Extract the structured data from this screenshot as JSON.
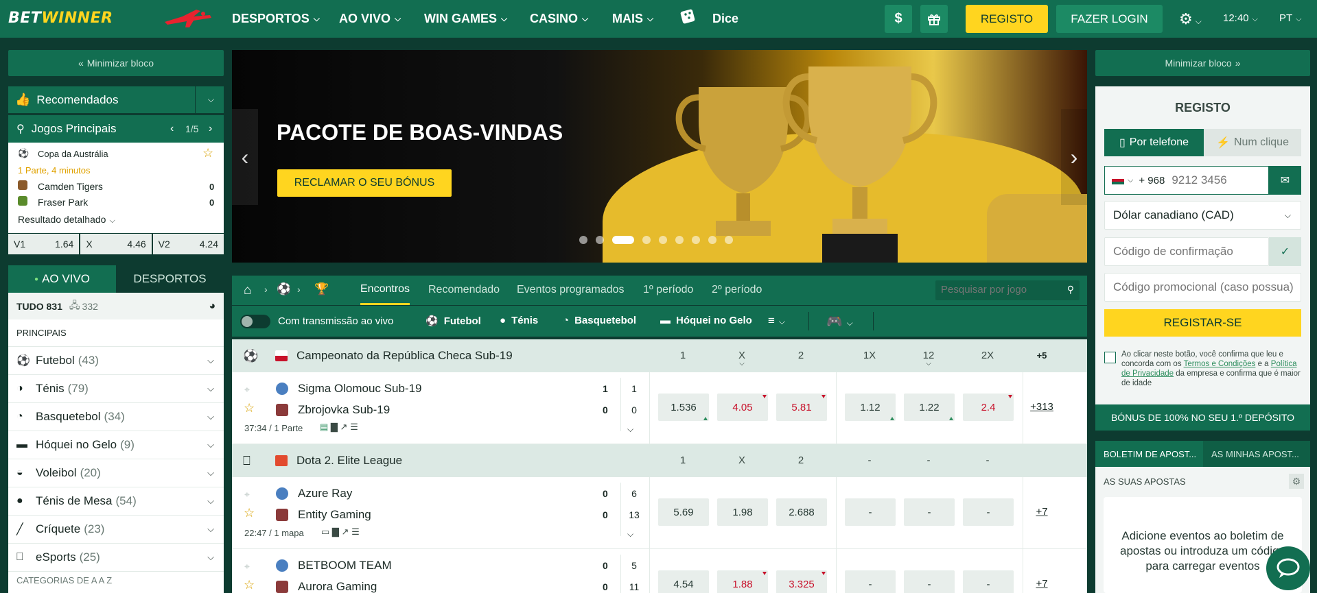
{
  "header": {
    "logo_bet": "BET",
    "logo_winner": "WINNER",
    "nav": [
      {
        "label": "DESPORTOS"
      },
      {
        "label": "AO VIVO"
      },
      {
        "label": "WIN GAMES"
      },
      {
        "label": "CASINO"
      },
      {
        "label": "MAIS"
      }
    ],
    "dice_label": "Dice",
    "register": "REGISTO",
    "login": "FAZER LOGIN",
    "time": "12:40",
    "lang": "PT"
  },
  "left": {
    "minimize": "Minimizar bloco",
    "recommended": "Recomendados",
    "main_games": "Jogos Principais",
    "pager": "1/5",
    "featured": {
      "competition": "Copa da Austrália",
      "status": "1 Parte, 4 minutos",
      "team1": "Camden Tigers",
      "score1": "0",
      "team2": "Fraser Park",
      "score2": "0",
      "detail": "Resultado detalhado",
      "odds": [
        {
          "k": "V1",
          "v": "1.64"
        },
        {
          "k": "X",
          "v": "4.46"
        },
        {
          "k": "V2",
          "v": "4.24"
        }
      ]
    },
    "tab_live": "AO VIVO",
    "tab_sports": "DESPORTOS",
    "all_label": "TUDO 831",
    "screen_count": "332",
    "principal": "PRINCIPAIS",
    "sports": [
      {
        "name": "Futebol",
        "count": "(43)",
        "icon": "soccer-ball-icon"
      },
      {
        "name": "Ténis",
        "count": "(79)",
        "icon": "tennis-ball-icon"
      },
      {
        "name": "Basquetebol",
        "count": "(34)",
        "icon": "basketball-icon"
      },
      {
        "name": "Hóquei no Gelo",
        "count": "(9)",
        "icon": "hockey-puck-icon"
      },
      {
        "name": "Voleibol",
        "count": "(20)",
        "icon": "volleyball-icon"
      },
      {
        "name": "Ténis de Mesa",
        "count": "(54)",
        "icon": "table-tennis-icon"
      },
      {
        "name": "Críquete",
        "count": "(23)",
        "icon": "cricket-icon"
      },
      {
        "name": "eSports",
        "count": "(25)",
        "icon": "gamepad-icon"
      }
    ],
    "categories": "CATEGORIAS DE A A Z"
  },
  "banner": {
    "title": "PACOTE DE BOAS-VINDAS",
    "cta": "RECLAMAR O SEU BÓNUS",
    "dots": 9,
    "active_dot": 3
  },
  "center": {
    "tabs": [
      "Encontros",
      "Recomendado",
      "Eventos programados",
      "1º período",
      "2º período"
    ],
    "search_placeholder": "Pesquisar por jogo",
    "live_stream": "Com transmissão ao vivo",
    "filters": [
      "Futebol",
      "Ténis",
      "Basquetebol",
      "Hóquei no Gelo"
    ],
    "leagues": [
      {
        "name": "Campeonato da República Checa Sub-19",
        "cols": [
          "1",
          "X",
          "2",
          "1X",
          "12",
          "2X"
        ],
        "more": "+5",
        "matches": [
          {
            "t1": "Sigma Olomouc Sub-19",
            "t2": "Zbrojovka Sub-19",
            "s1": "1",
            "s2": "0",
            "p1": "1",
            "p2": "0",
            "info": "37:34 / 1 Parte",
            "odds": [
              "1.536",
              "4.05",
              "5.81",
              "1.12",
              "1.22",
              "2.4"
            ],
            "more": "+313"
          }
        ]
      },
      {
        "name": "Dota 2. Elite League",
        "cols": [
          "1",
          "X",
          "2",
          "-",
          "-",
          "-"
        ],
        "matches": [
          {
            "t1": "Azure Ray",
            "t2": "Entity Gaming",
            "s1": "0",
            "s2": "0",
            "p1": "6",
            "p2": "13",
            "info": "22:47 / 1 mapa",
            "odds": [
              "5.69",
              "1.98",
              "2.688",
              "-",
              "-",
              "-"
            ],
            "more": "+7"
          },
          {
            "t1": "BETBOOM TEAM",
            "t2": "Aurora Gaming",
            "s1": "0",
            "s2": "0",
            "p1": "5",
            "p2": "11",
            "info": "",
            "odds": [
              "4.54",
              "1.88",
              "3.325",
              "-",
              "-",
              "-"
            ],
            "more": "+7"
          }
        ]
      }
    ]
  },
  "right": {
    "minimize": "Minimizar bloco",
    "title": "REGISTO",
    "by_phone": "Por telefone",
    "one_click": "Num clique",
    "phone_code": "+ 968",
    "phone_placeholder": "9212 3456",
    "currency": "Dólar canadiano (CAD)",
    "confirm_placeholder": "Código de confirmação",
    "promo_placeholder": "Código promocional (caso possua)",
    "submit": "REGISTAR-SE",
    "terms_1": "Ao clicar neste botão, você confirma que leu e concorda com os ",
    "terms_link1": "Termos e Condições",
    "terms_2": " e a ",
    "terms_link2": "Política de Privacidade",
    "terms_3": " da empresa e confirma que é maior de idade",
    "bonus": "BÓNUS DE 100% NO SEU 1.º DEPÓSITO",
    "tab_slip": "BOLETIM DE APOST...",
    "tab_my": "AS MINHAS APOST...",
    "your_bets": "AS SUAS APOSTAS",
    "empty": "Adicione eventos ao boletim de apostas ou introduza um código para carregar eventos"
  },
  "colors": {
    "brand": "#126e51",
    "accent": "#ffd51f",
    "bg": "#0d3b30",
    "odds_down": "#c8122b",
    "odds_up": "#2e8e5e"
  }
}
